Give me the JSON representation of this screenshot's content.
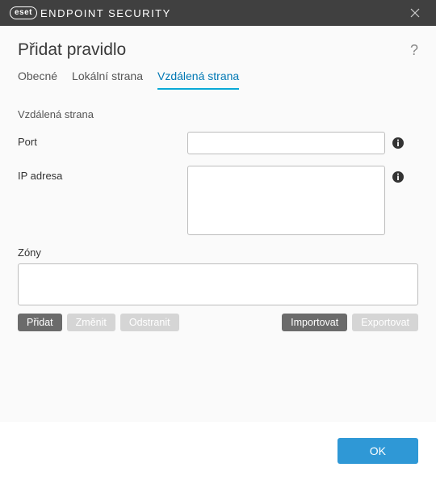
{
  "titlebar": {
    "brand": "eset",
    "product": "ENDPOINT SECURITY"
  },
  "page": {
    "title": "Přidat pravidlo"
  },
  "tabs": {
    "general": "Obecné",
    "local": "Lokální strana",
    "remote": "Vzdálená strana",
    "active": "remote"
  },
  "form": {
    "section_heading": "Vzdálená strana",
    "port": {
      "label": "Port",
      "value": ""
    },
    "ip": {
      "label": "IP adresa",
      "value": ""
    },
    "zones": {
      "label": "Zóny",
      "value": ""
    }
  },
  "buttons": {
    "add": "Přidat",
    "edit": "Změnit",
    "remove": "Odstranit",
    "import": "Importovat",
    "export": "Exportovat",
    "ok": "OK"
  }
}
